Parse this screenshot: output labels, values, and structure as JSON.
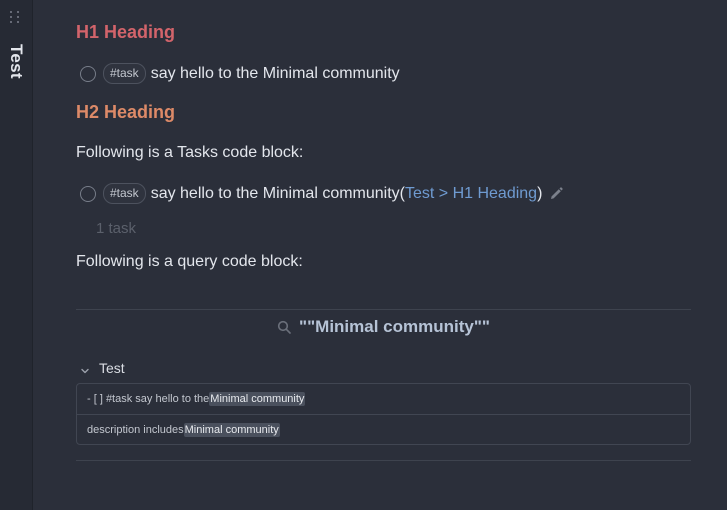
{
  "sidebar": {
    "title": "Test"
  },
  "note": {
    "h1": "H1 Heading",
    "task1": {
      "tag": "#task",
      "text": "say hello to the Minimal community"
    },
    "h2": "H2 Heading",
    "para_tasks": "Following is a Tasks code block:",
    "task2": {
      "tag": "#task",
      "text": "say hello to the Minimal community",
      "open_paren": " (",
      "backlink": "Test > H1 Heading",
      "close_paren": ")"
    },
    "task_count": "1 task",
    "para_query": "Following is a query code block:"
  },
  "query": {
    "title": "\"\"Minimal community\"\"",
    "file": "Test",
    "matches": [
      {
        "prefix": "- [ ] #task say hello to the ",
        "highlight": "Minimal community"
      },
      {
        "prefix": "description includes ",
        "highlight": "Minimal community"
      }
    ]
  },
  "colors": {
    "background": "#2b2f3a",
    "h1": "#d3646b",
    "h2": "#dd8a68",
    "link": "#6f9bd1",
    "query_title": "#b6c3d6"
  },
  "icons": [
    "drag-handle-icon",
    "checkbox-icon",
    "pencil-icon",
    "search-icon",
    "chevron-down-icon"
  ]
}
